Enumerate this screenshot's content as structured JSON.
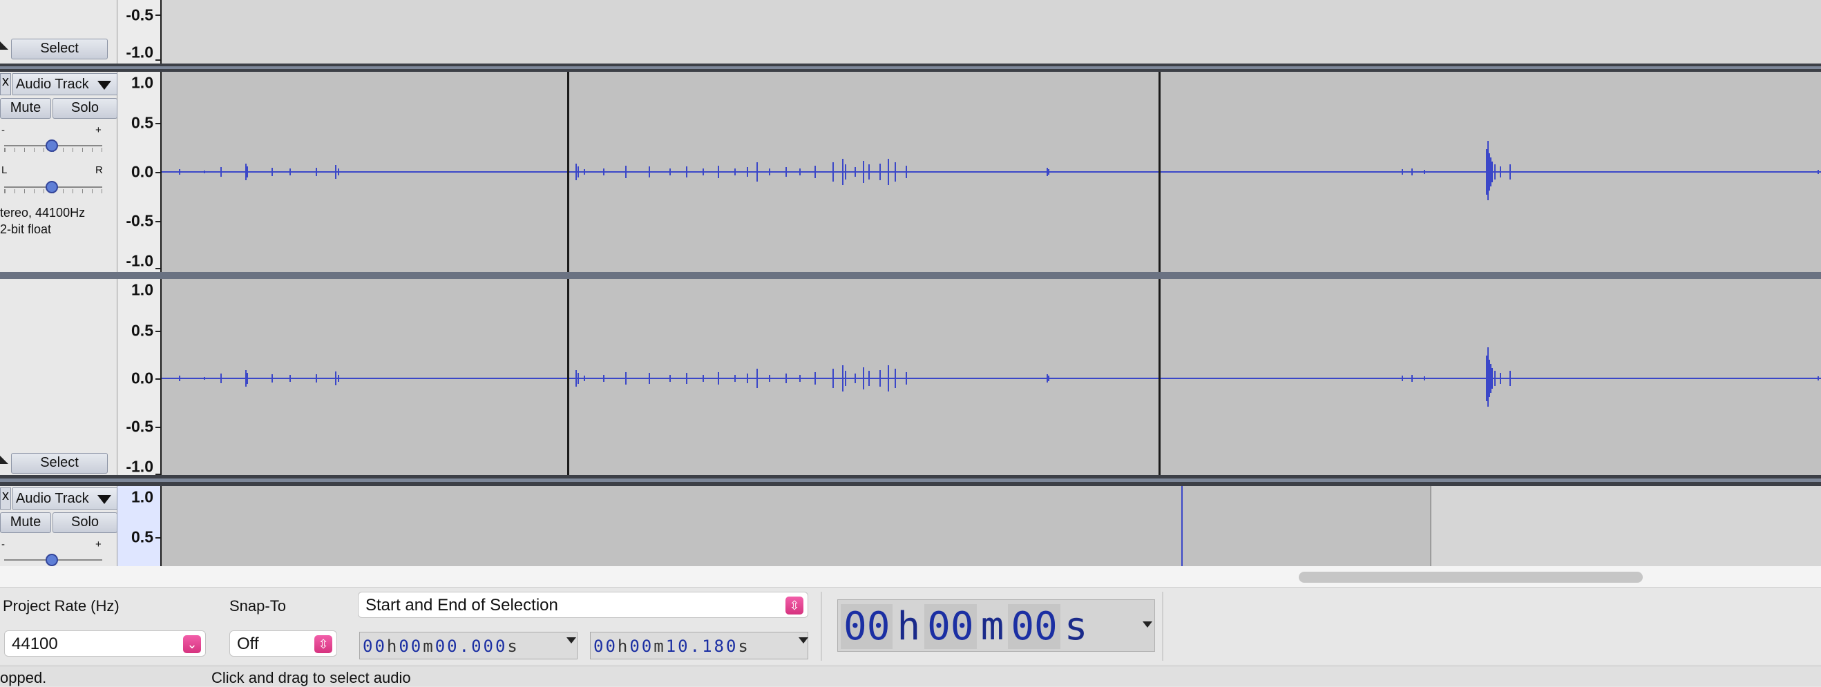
{
  "tracks": {
    "select_label": "Select",
    "track1": {
      "name": "Audio Track",
      "mute": "Mute",
      "solo": "Solo",
      "gain_minus": "-",
      "gain_plus": "+",
      "pan_left": "L",
      "pan_right": "R",
      "info_line1": "tereo, 44100Hz",
      "info_line2": "2-bit float",
      "select_label": "Select",
      "close": "x"
    },
    "track2": {
      "name": "Audio Track",
      "mute": "Mute",
      "solo": "Solo",
      "gain_minus": "-",
      "gain_plus": "+",
      "close": "x"
    },
    "ruler_top": [
      "-0.5",
      "-1.0"
    ],
    "ruler_channel": [
      "1.0",
      "0.5",
      "0.0",
      "-0.5",
      "-1.0"
    ],
    "ruler_partial": [
      "1.0",
      "0.5"
    ],
    "wave_color": "#3b47c8"
  },
  "toolbar": {
    "project_rate_label": "Project Rate (Hz)",
    "project_rate_value": "44100",
    "snap_to_label": "Snap-To",
    "snap_to_value": "Off",
    "selection_mode": "Start and End of Selection",
    "start_time": {
      "h": "00",
      "h_unit": "h",
      "m": "00",
      "m_unit": "m",
      "s": "00.000",
      "s_unit": "s"
    },
    "end_time": {
      "h": "00",
      "h_unit": "h",
      "m": "00",
      "m_unit": "m",
      "s": "10.180",
      "s_unit": "s"
    },
    "audio_position": {
      "h": "00",
      "h_unit": "h",
      "m": "00",
      "m_unit": "m",
      "s": "00",
      "s_unit": "s"
    },
    "accent_color": "#e0479a",
    "time_color": "#1b2fa3"
  },
  "status": {
    "left": "opped.",
    "right": "Click and drag to select audio"
  },
  "icons": [
    "close-icon",
    "dropdown-arrow-icon",
    "chevron-updown-icon",
    "collapse-triangle-icon"
  ]
}
